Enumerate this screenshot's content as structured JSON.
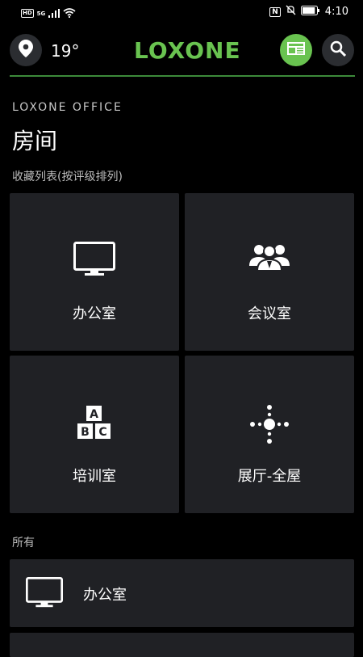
{
  "statusbar": {
    "hd": "HD",
    "network": "5G",
    "nfc": "N",
    "time": "4:10",
    "battery_level": 0.9
  },
  "header": {
    "location_icon": "location-pin-icon",
    "temperature": "19°",
    "logo": "LOXONE",
    "news_icon": "newspaper-icon",
    "search_icon": "search-icon",
    "accent_color": "#69c350"
  },
  "page": {
    "subtitle": "LOXONE OFFICE",
    "title": "房间",
    "favorites_label": "收藏列表(按评级排列)",
    "all_label": "所有"
  },
  "favorites": [
    {
      "label": "办公室",
      "icon": "monitor-icon"
    },
    {
      "label": "会议室",
      "icon": "people-group-icon"
    },
    {
      "label": "培训室",
      "icon": "abc-blocks-icon"
    },
    {
      "label": "展厅-全屋",
      "icon": "dots-cross-icon"
    }
  ],
  "all_rooms": [
    {
      "label": "办公室",
      "icon": "monitor-icon"
    }
  ]
}
